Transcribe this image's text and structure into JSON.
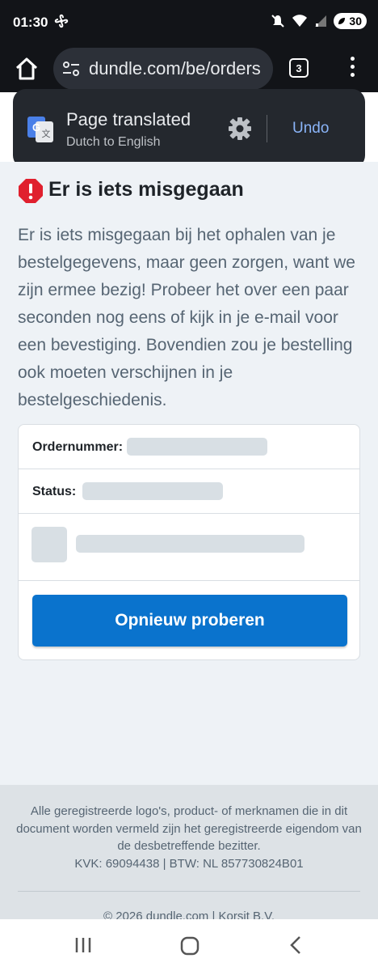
{
  "status_bar": {
    "time": "01:30",
    "battery": "30"
  },
  "browser": {
    "url": "dundle.com/be/orders",
    "tab_count": "3"
  },
  "translate_popup": {
    "title": "Page translated",
    "subtitle": "Dutch to English",
    "undo": "Undo"
  },
  "error": {
    "title": "Er is iets misgegaan",
    "message": "Er is iets misgegaan bij het ophalen van je bestelgegevens, maar geen zorgen, want we zijn ermee bezig! Probeer het over een paar seconden nog eens of kijk in je e-mail voor een bevestiging. Bovendien zou je bestelling ook moeten verschijnen in je bestelgeschiedenis."
  },
  "order_card": {
    "order_number_label": "Ordernummer:",
    "status_label": "Status:",
    "retry_button": "Opnieuw proberen"
  },
  "footer": {
    "legal": "Alle geregistreerde logo's, product- of merknamen die in dit document worden vermeld zijn het geregistreerde eigendom van de desbetreffende bezitter.",
    "registration": "KVK: 69094438 | BTW: NL 857730824B01",
    "copyright": "© 2026 dundle.com | Korsit B.V."
  },
  "colors": {
    "accent": "#0a73cd",
    "error": "#e0202e",
    "link": "#8ab4f8"
  }
}
